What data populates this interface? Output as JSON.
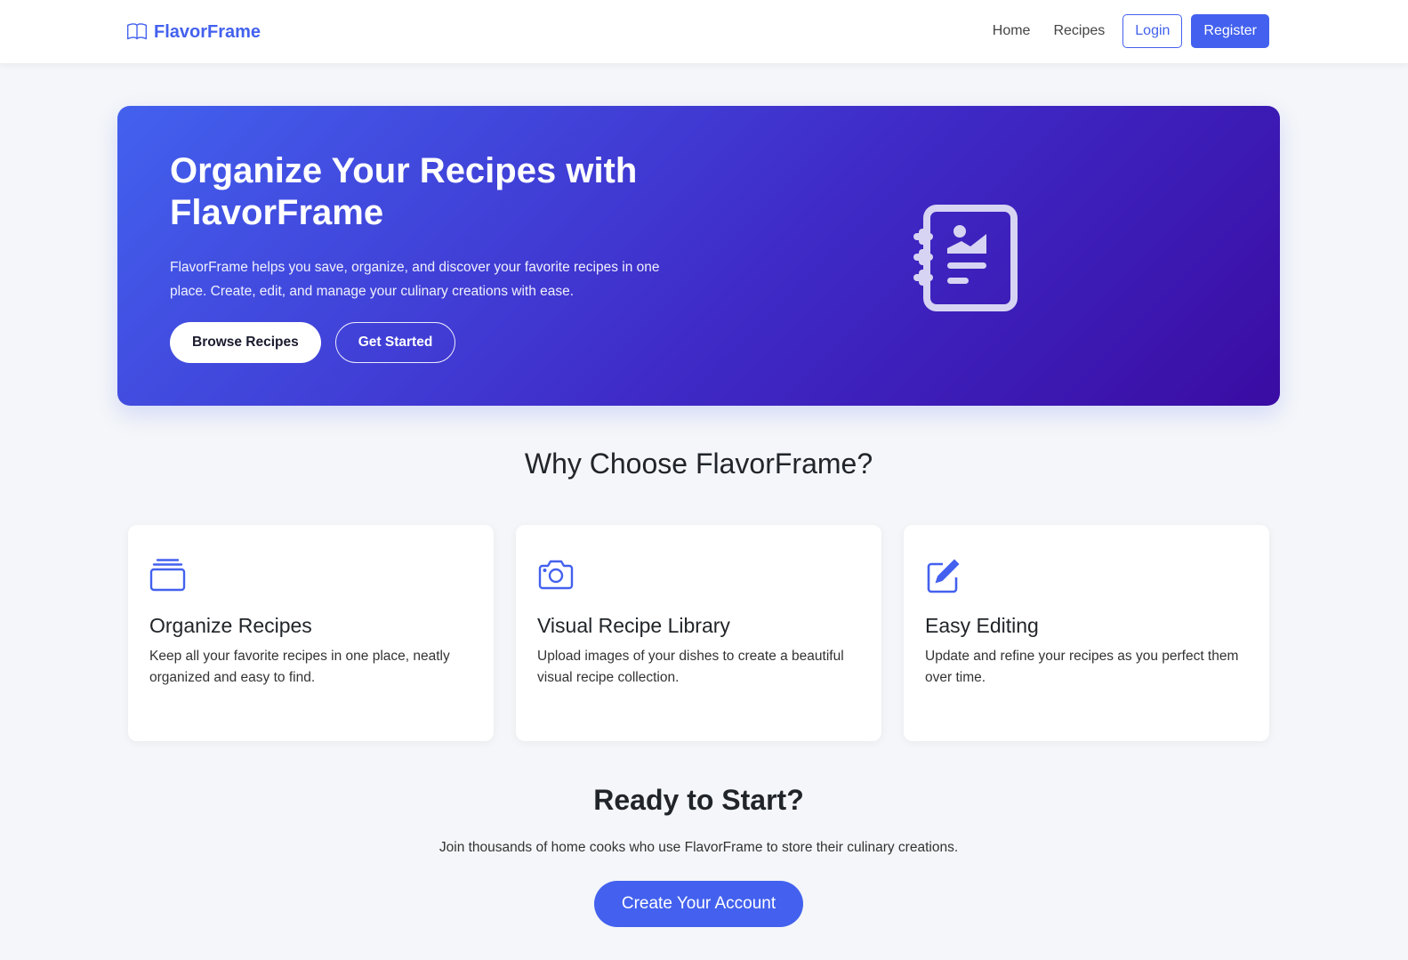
{
  "navbar": {
    "brand": "FlavorFrame",
    "links": [
      "Home",
      "Recipes"
    ],
    "login_label": "Login",
    "register_label": "Register"
  },
  "hero": {
    "title": "Organize Your Recipes with FlavorFrame",
    "text": "FlavorFrame helps you save, organize, and discover your favorite recipes in one place. Create, edit, and manage your culinary creations with ease.",
    "browse_label": "Browse Recipes",
    "started_label": "Get Started",
    "icon": "recipe-notebook-icon"
  },
  "features": {
    "title": "Why Choose FlavorFrame?",
    "cards": [
      {
        "icon": "collection-icon",
        "title": "Organize Recipes",
        "text": "Keep all your favorite recipes in one place, neatly organized and easy to find."
      },
      {
        "icon": "camera-icon",
        "title": "Visual Recipe Library",
        "text": "Upload images of your dishes to create a beautiful visual recipe collection."
      },
      {
        "icon": "edit-icon",
        "title": "Easy Editing",
        "text": "Update and refine your recipes as you perfect them over time."
      }
    ]
  },
  "cta": {
    "title": "Ready to Start?",
    "text": "Join thousands of home cooks who use FlavorFrame to store their culinary creations.",
    "button_label": "Create Your Account"
  },
  "colors": {
    "accent": "#4361ee",
    "hero_gradient_start": "#4361ee",
    "hero_gradient_end": "#3a0ca3",
    "background": "#f4f6f9"
  }
}
